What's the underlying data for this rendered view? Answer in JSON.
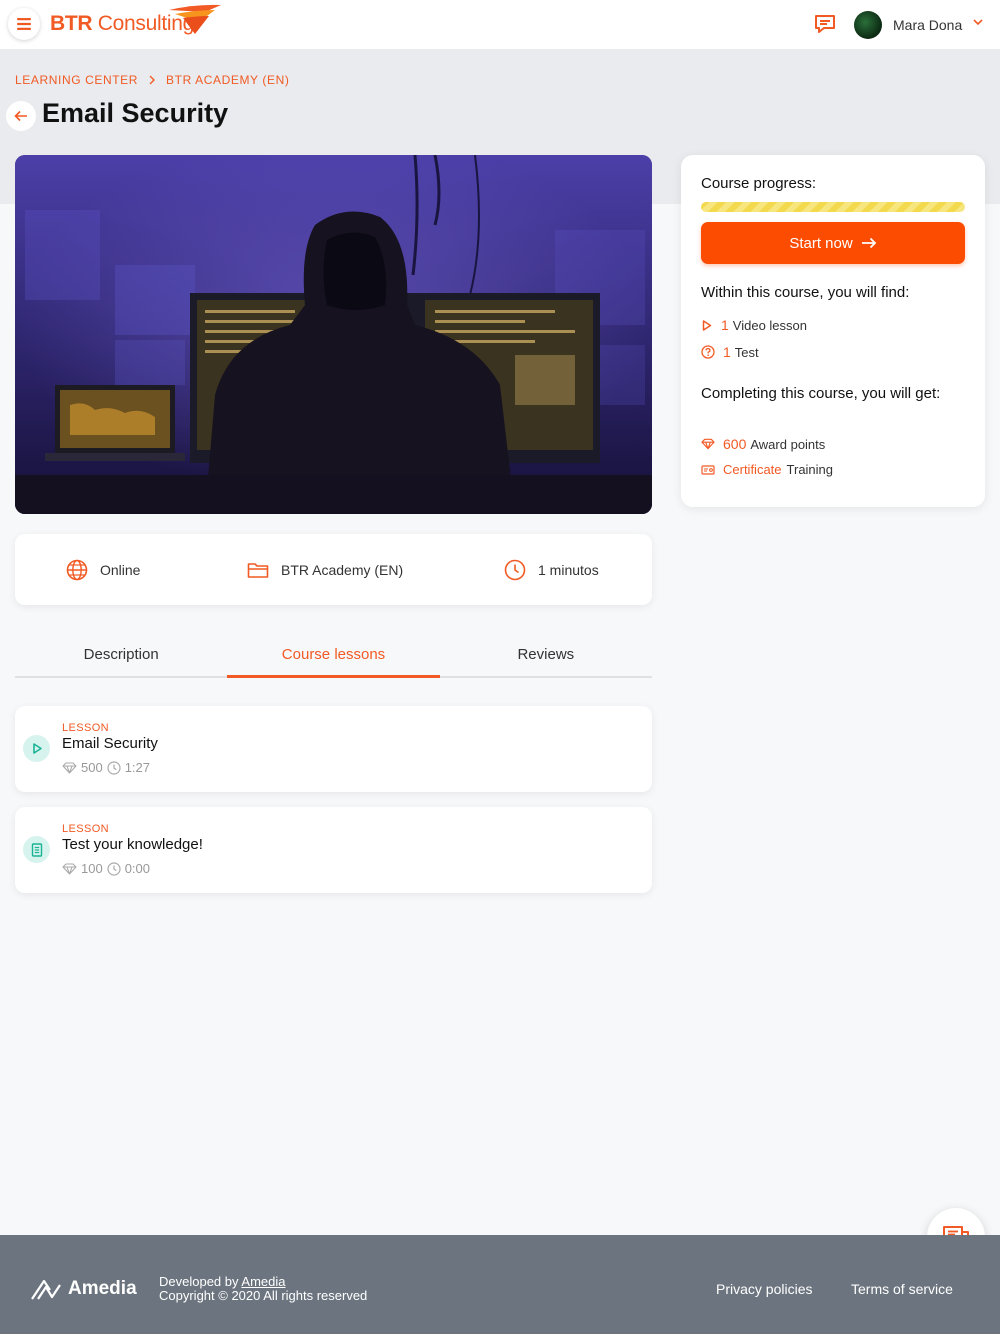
{
  "header": {
    "logo_text_bold": "BTR",
    "logo_text": " Consulting",
    "user_name": "Mara Dona"
  },
  "breadcrumb": {
    "items": [
      "LEARNING CENTER",
      "BTR ACADEMY (EN)"
    ]
  },
  "page": {
    "title": "Email Security"
  },
  "meta": {
    "mode": "Online",
    "academy": "BTR Academy (EN)",
    "duration": "1 minutos"
  },
  "tabs": [
    {
      "label": "Description",
      "active": false
    },
    {
      "label": "Course lessons",
      "active": true
    },
    {
      "label": "Reviews",
      "active": false
    }
  ],
  "lessons": [
    {
      "tag": "LESSON",
      "title": "Email Security",
      "points": "500",
      "time": "1:27",
      "icon": "play-icon"
    },
    {
      "tag": "LESSON",
      "title": "Test your knowledge!",
      "points": "100",
      "time": "0:00",
      "icon": "document-icon"
    }
  ],
  "sidebar": {
    "progress_label": "Course progress:",
    "progress_value": 0,
    "start_label": "Start now",
    "within_label": "Within this course, you will find:",
    "video_count": "1",
    "video_label": "Video lesson",
    "test_count": "1",
    "test_label": "Test",
    "completing_label": "Completing this course, you will get:",
    "award_points": "600",
    "award_label": "Award points",
    "certificate_word": "Certificate",
    "certificate_label": "Training"
  },
  "footer": {
    "brand": "Amedia",
    "developed_by": "Developed by ",
    "developer_link": "Amedia",
    "copyright": "Copyright © 2020 All rights reserved",
    "privacy": "Privacy policies",
    "terms": "Terms of service"
  },
  "colors": {
    "accent": "#f15a24",
    "button": "#fc4c02",
    "footer_bg": "#6c757f",
    "lesson_icon_bg": "#d6f3ee"
  }
}
